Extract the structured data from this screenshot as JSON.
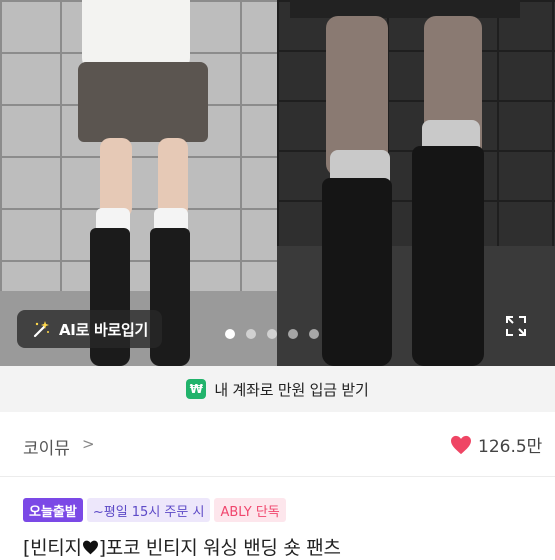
{
  "hero": {
    "ai_button_label": "AI로 바로입기",
    "carousel_dots": 5,
    "active_dot": 0
  },
  "account_bar": {
    "badge": "₩",
    "text": "내 계좌로 만원 입금 받기",
    "badge_color": "#21b36b"
  },
  "shop": {
    "name": "코이뮤",
    "chevron": ">",
    "like_count": "126.5만",
    "heart_color": "#ef4564"
  },
  "tags": [
    {
      "label": "오늘출발"
    },
    {
      "label": "~평일 15시 주문 시"
    },
    {
      "label": "ABLY 단독"
    }
  ],
  "product": {
    "title_prefix": "[빈티지",
    "title_suffix": "]포코 빈티지 워싱 밴딩 숏 팬츠"
  },
  "colors": {
    "accent_purple": "#7b49e6",
    "ably_pink": "#f0466d"
  }
}
